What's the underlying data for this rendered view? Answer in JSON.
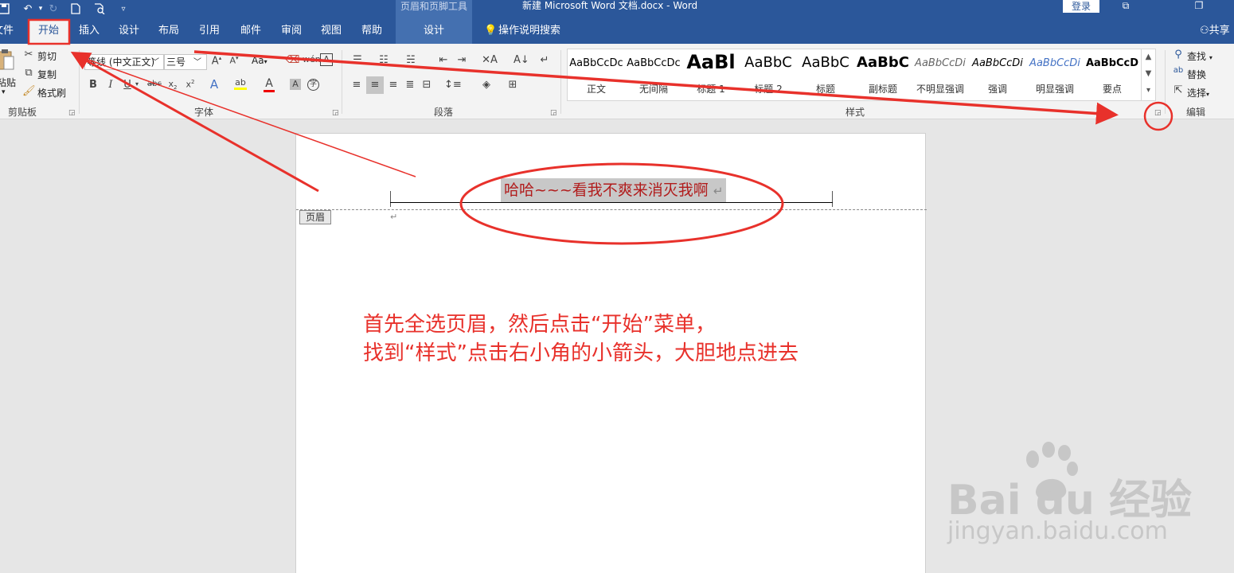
{
  "title_bar": {
    "context_tool": "页眉和页脚工具",
    "doc_title": "新建 Microsoft Word 文档.docx  -  Word",
    "login": "登录",
    "quick_access": [
      "save-icon",
      "undo-icon",
      "redo-icon",
      "new-doc-icon",
      "print-preview-icon",
      "customize-icon"
    ],
    "window_buttons": [
      "ribbon-display-icon",
      "restore-icon"
    ]
  },
  "tabs": {
    "file": "文件",
    "home": "开始",
    "insert": "插入",
    "design": "设计",
    "layout": "布局",
    "references": "引用",
    "mailings": "邮件",
    "review": "审阅",
    "view": "视图",
    "help": "帮助",
    "hf_design": "设计",
    "tell_me": "操作说明搜索",
    "share": "共享"
  },
  "clipboard": {
    "paste": "粘贴",
    "cut": "剪切",
    "copy": "复制",
    "format_painter": "格式刷",
    "label": "剪贴板"
  },
  "font": {
    "font_name": "等线 (中文正文)",
    "font_size": "三号",
    "change_case": "Aa",
    "label": "字体"
  },
  "paragraph": {
    "label": "段落"
  },
  "styles": {
    "label": "样式",
    "items": [
      {
        "preview": "AaBbCcDc",
        "name": "正文"
      },
      {
        "preview": "AaBbCcDc",
        "name": "无间隔"
      },
      {
        "preview": "AaBl",
        "name": "标题 1"
      },
      {
        "preview": "AaBbC",
        "name": "标题 2"
      },
      {
        "preview": "AaBbC",
        "name": "标题"
      },
      {
        "preview": "AaBbC",
        "name": "副标题"
      },
      {
        "preview": "AaBbCcDi",
        "name": "不明显强调"
      },
      {
        "preview": "AaBbCcDi",
        "name": "强调"
      },
      {
        "preview": "AaBbCcDi",
        "name": "明显强调"
      },
      {
        "preview": "AaBbCcD",
        "name": "要点"
      }
    ]
  },
  "editing": {
    "find": "查找",
    "replace": "替换",
    "select": "选择",
    "label": "编辑"
  },
  "document": {
    "header_text": "哈哈~~~看我不爽来消灭我啊",
    "return_mark": "↵",
    "header_tag": "页眉",
    "instruction_line1": "首先全选页眉，然后点击“开始”菜单，",
    "instruction_line2": "找到“样式”点击右小角的小箭头，大胆地点进去"
  },
  "watermark": {
    "logo": "Bai du 经验",
    "url": "jingyan.baidu.com"
  },
  "colors": {
    "word_blue": "#2b579a",
    "annotation_red": "#e8312b",
    "header_text": "#b11d1d"
  }
}
